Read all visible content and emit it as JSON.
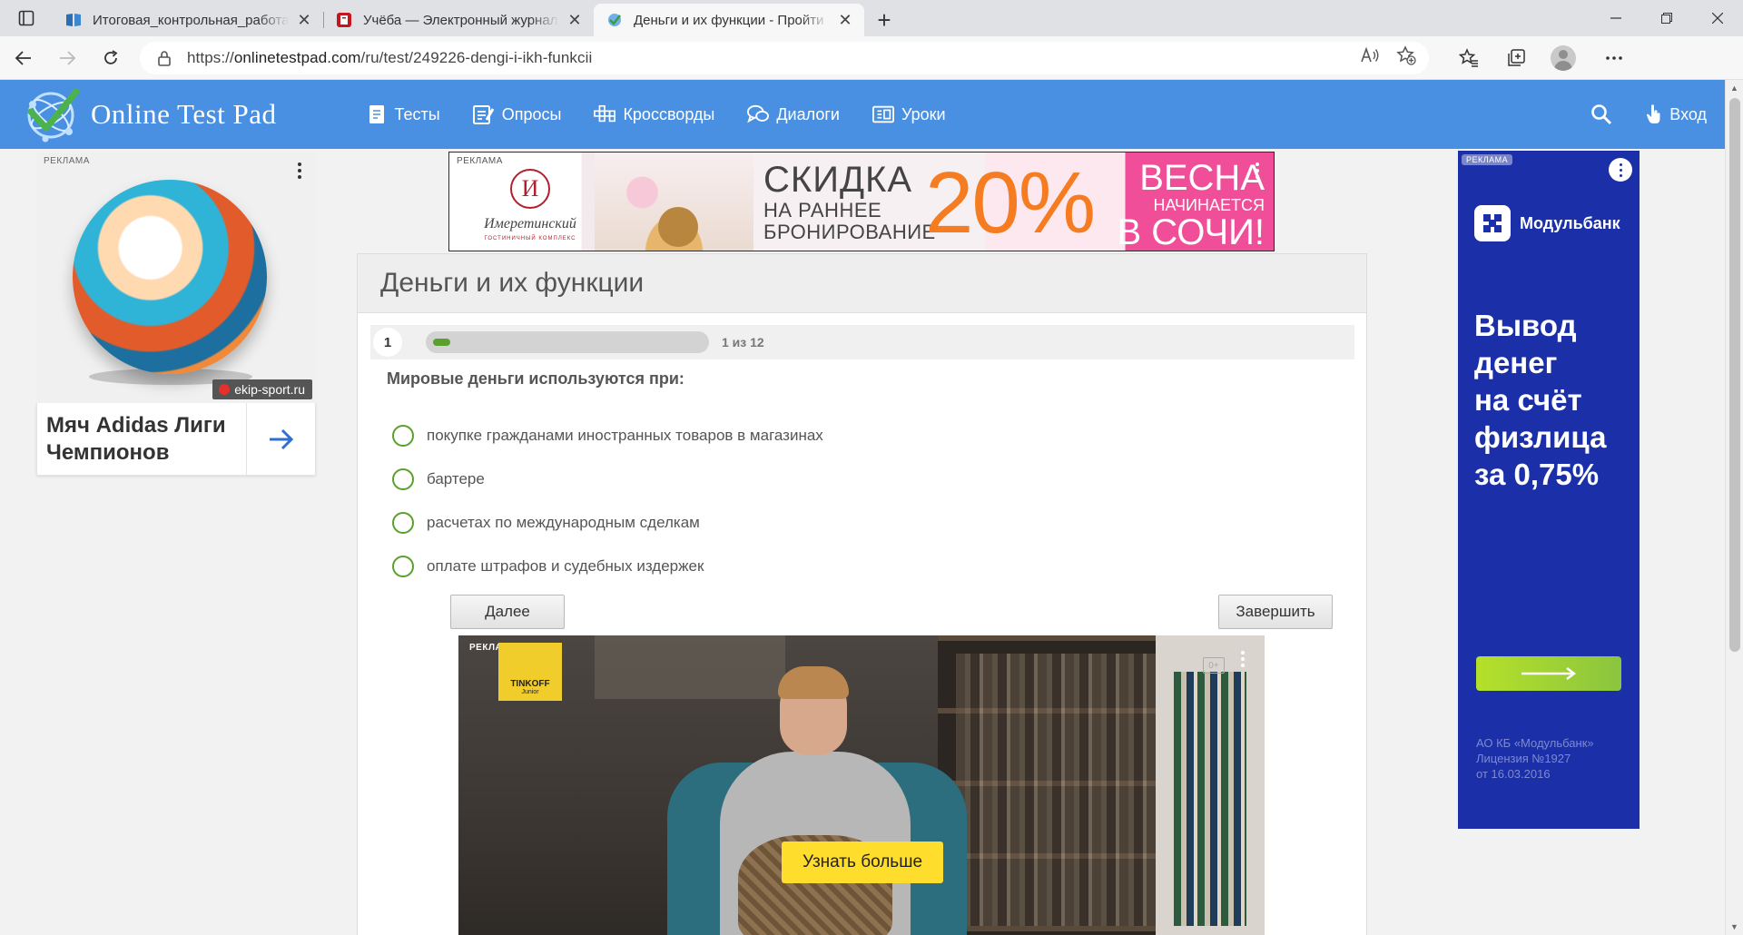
{
  "browser": {
    "tabs": [
      {
        "title": "Итоговая_контрольная_работа",
        "active": false
      },
      {
        "title": "Учёба — Электронный журнал",
        "active": false
      },
      {
        "title": "Деньги и их функции - Пройти",
        "active": true
      }
    ],
    "url_scheme": "https://",
    "url_host": "onlinetestpad.com",
    "url_path": "/ru/test/249226-dengi-i-ikh-funkcii"
  },
  "site": {
    "logo_text": "Online Test Pad",
    "nav": [
      {
        "label": "Тесты",
        "icon": "document-icon"
      },
      {
        "label": "Опросы",
        "icon": "survey-icon"
      },
      {
        "label": "Кроссворды",
        "icon": "crossword-icon"
      },
      {
        "label": "Диалоги",
        "icon": "chat-icon"
      },
      {
        "label": "Уроки",
        "icon": "lesson-icon"
      }
    ],
    "login_label": "Вход"
  },
  "left_ad": {
    "label": "РЕКЛАМА",
    "source": "ekip-sport.ru",
    "product": "Мяч Adidas Лиги Чемпионов"
  },
  "top_banner": {
    "label": "РЕКЛАМА",
    "hotel_letter": "И",
    "hotel_name": "Имеретинский",
    "hotel_sub": "ГОСТИНИЧНЫЙ КОМПЛЕКС",
    "discount_word": "СКИДКА",
    "early_line1": "НА РАННЕЕ",
    "early_line2": "БРОНИРОВАНИЕ",
    "percent": "20%",
    "spring_line1": "ВЕСНА",
    "spring_line2": "НАЧИНАЕТСЯ",
    "spring_line3": "В СОЧИ!"
  },
  "test": {
    "title": "Деньги и их функции",
    "question_number": "1",
    "progress_text": "1 из 12",
    "progress": {
      "current": 1,
      "total": 12
    },
    "question": "Мировые деньги используются при:",
    "answers": [
      "покупке гражданами иностранных товаров в магазинах",
      "бартере",
      "расчетах по международным сделкам",
      "оплате штрафов и судебных издержек"
    ],
    "next_label": "Далее",
    "finish_label": "Завершить"
  },
  "video_ad": {
    "label": "РЕКЛАМА",
    "brand": "TINKOFF",
    "brand_sub": "Junior",
    "age": "0+",
    "cta": "Узнать больше"
  },
  "right_ad": {
    "label": "РЕКЛАМА",
    "brand": "Модульбанк",
    "headline": "Вывод\nденег\nна счёт\nфизлица\nза 0,75%",
    "legal": "АО КБ «Модульбанк»\nЛицензия №1927\nот 16.03.2016"
  },
  "colors": {
    "site_blue": "#4a90e2",
    "accent_green": "#5aa02c",
    "modulbank_blue": "#1a2fa8",
    "cta_yellow": "#ffdd2d"
  }
}
